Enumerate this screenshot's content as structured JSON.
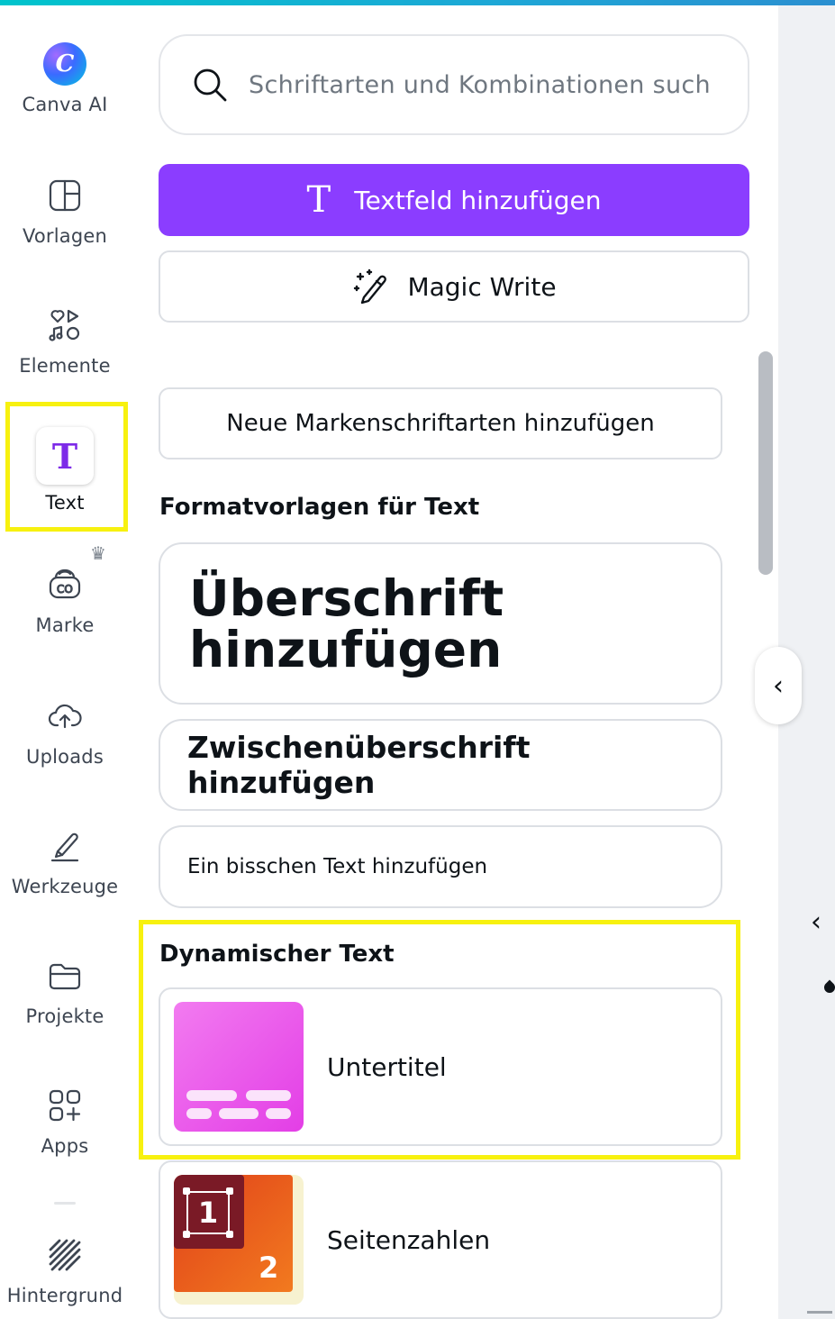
{
  "rail": {
    "items": [
      {
        "label": "Canva AI"
      },
      {
        "label": "Vorlagen"
      },
      {
        "label": "Elemente"
      },
      {
        "label": "Text"
      },
      {
        "label": "Marke"
      },
      {
        "label": "Uploads"
      },
      {
        "label": "Werkzeuge"
      },
      {
        "label": "Projekte"
      },
      {
        "label": "Apps"
      },
      {
        "label": "Hintergrund"
      }
    ],
    "active": "Text"
  },
  "search": {
    "placeholder": "Schriftarten und Kombinationen such"
  },
  "buttons": {
    "add_textbox": "Textfeld hinzufügen",
    "magic_write": "Magic Write",
    "brand_fonts": "Neue Markenschriftarten hinzufügen"
  },
  "sections": {
    "text_styles": "Formatvorlagen für Text",
    "dynamic_text": "Dynamischer Text"
  },
  "text_styles": {
    "heading": "Überschrift hinzufügen",
    "subheading": "Zwischenüberschrift hinzufügen",
    "body": "Ein bisschen Text hinzufügen"
  },
  "dynamic_text": {
    "items": [
      {
        "label": "Untertitel"
      },
      {
        "label": "Seitenzahlen",
        "thumb_numbers": [
          "1",
          "2"
        ]
      }
    ]
  },
  "colors": {
    "accent": "#8b3dff",
    "highlight": "#f7f10f",
    "text_icon": "#7d2ae8"
  },
  "icons": {
    "ai": "C",
    "text_tile": "T",
    "add_textbox": "T",
    "collapse": "‹",
    "side_chevron": "‹",
    "crown": "♛"
  }
}
